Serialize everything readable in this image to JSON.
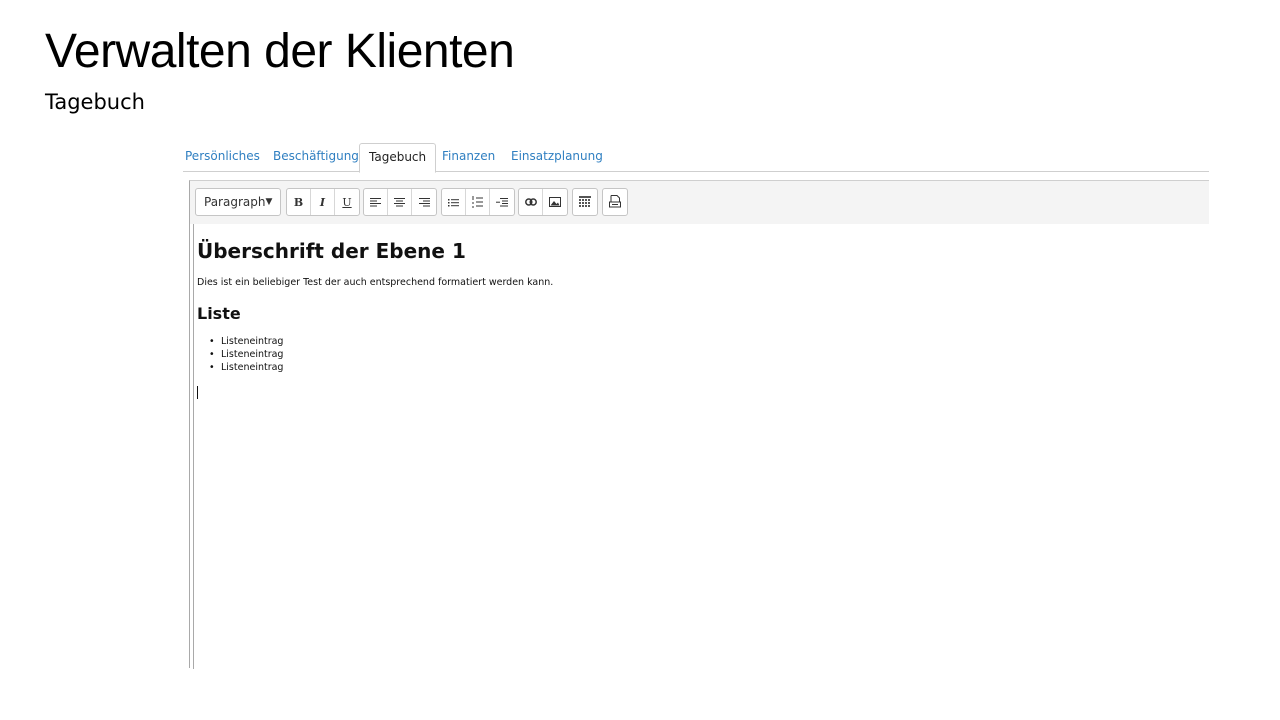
{
  "slide": {
    "title": "Verwalten der Klienten",
    "subtitle": "Tagebuch"
  },
  "tabs": [
    {
      "label": "Persönliches",
      "active": false
    },
    {
      "label": "Beschäftigung",
      "active": false
    },
    {
      "label": "Tagebuch",
      "active": true
    },
    {
      "label": "Finanzen",
      "active": false
    },
    {
      "label": "Einsatzplanung",
      "active": false
    }
  ],
  "colors": {
    "tab_link": "#2f7fc1",
    "toolbar_bg": "#f4f4f4"
  },
  "toolbar": {
    "format_select": "Paragraph",
    "icons": [
      "bold-icon",
      "italic-icon",
      "underline-icon",
      "align-left-icon",
      "align-center-icon",
      "align-right-icon",
      "bullet-list-icon",
      "numbered-list-icon",
      "outdent-icon",
      "link-icon",
      "image-icon",
      "table-icon",
      "print-icon"
    ],
    "bold_label": "B",
    "italic_label": "I",
    "underline_label": "U"
  },
  "document": {
    "heading1": "Überschrift der Ebene 1",
    "paragraph": "Dies ist ein beliebiger Test der auch entsprechend formatiert werden kann.",
    "heading2": "Liste",
    "list_items": [
      "Listeneintrag",
      "Listeneintrag",
      "Listeneintrag"
    ]
  }
}
